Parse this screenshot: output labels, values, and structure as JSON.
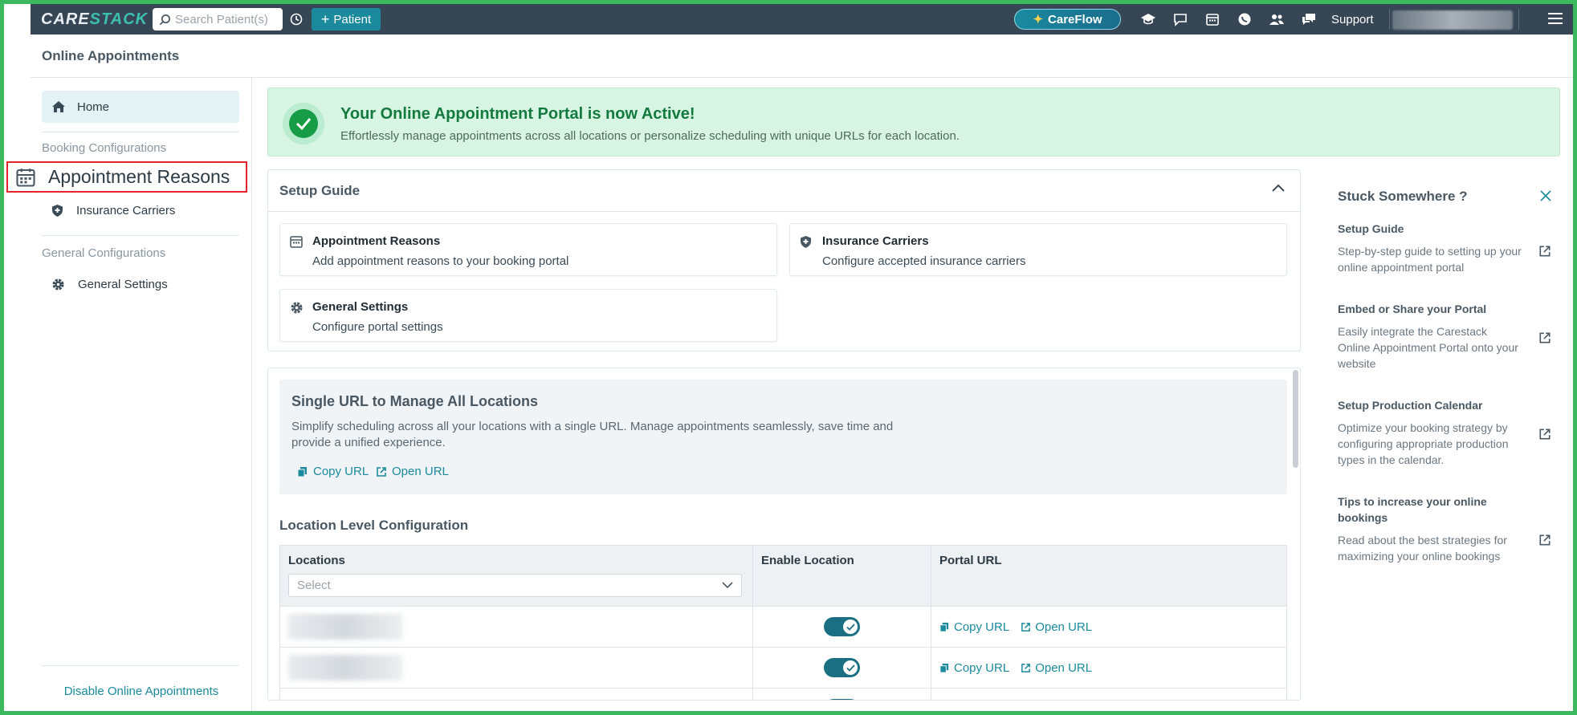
{
  "topbar": {
    "logo_part1": "CARE",
    "logo_part2": "STACK",
    "search_placeholder": "Search Patient(s)",
    "patient_button": "Patient",
    "careflow_label": "CareFlow",
    "support_label": "Support"
  },
  "header": {
    "title": "Online Appointments"
  },
  "sidebar": {
    "home": "Home",
    "booking_section": "Booking Configurations",
    "appointment_reasons": "Appointment Reasons",
    "insurance_carriers": "Insurance Carriers",
    "general_section": "General Configurations",
    "general_settings": "General Settings",
    "disable_link": "Disable Online Appointments"
  },
  "banner": {
    "title": "Your Online Appointment Portal is now Active!",
    "subtitle": "Effortlessly manage appointments across all locations or personalize scheduling with unique URLs for each location."
  },
  "setup_guide": {
    "title": "Setup Guide",
    "cards": [
      {
        "title": "Appointment Reasons",
        "desc": "Add appointment reasons to your booking portal"
      },
      {
        "title": "Insurance Carriers",
        "desc": "Configure accepted insurance carriers"
      },
      {
        "title": "General Settings",
        "desc": "Configure portal settings"
      }
    ]
  },
  "single_url": {
    "title": "Single URL to Manage All Locations",
    "desc": "Simplify scheduling across all your locations with a single URL. Manage appointments seamlessly, save time and provide a unified experience.",
    "copy_url": "Copy URL",
    "open_url": "Open URL"
  },
  "location_config": {
    "title": "Location Level Configuration",
    "columns": [
      "Locations",
      "Enable Location",
      "Portal URL"
    ],
    "select_placeholder": "Select",
    "rows": [
      {
        "enabled": true,
        "copy_url": "Copy URL",
        "open_url": "Open URL"
      },
      {
        "enabled": true,
        "copy_url": "Copy URL",
        "open_url": "Open URL"
      }
    ]
  },
  "help_panel": {
    "title": "Stuck Somewhere ?",
    "items": [
      {
        "title": "Setup Guide",
        "desc": "Step-by-step guide to setting up your online appointment portal"
      },
      {
        "title": "Embed or Share your Portal",
        "desc": "Easily integrate the Carestack Online Appointment Portal onto your website"
      },
      {
        "title": "Setup Production Calendar",
        "desc": "Optimize your booking strategy by configuring appropriate production types in the calendar."
      },
      {
        "title": "Tips to increase your online bookings",
        "desc": "Read about the best strategies for maximizing your online bookings"
      }
    ]
  },
  "colors": {
    "accent": "#1a8a9c",
    "topbar": "#364655",
    "success": "#169c45",
    "highlight_border": "#e3242b"
  }
}
